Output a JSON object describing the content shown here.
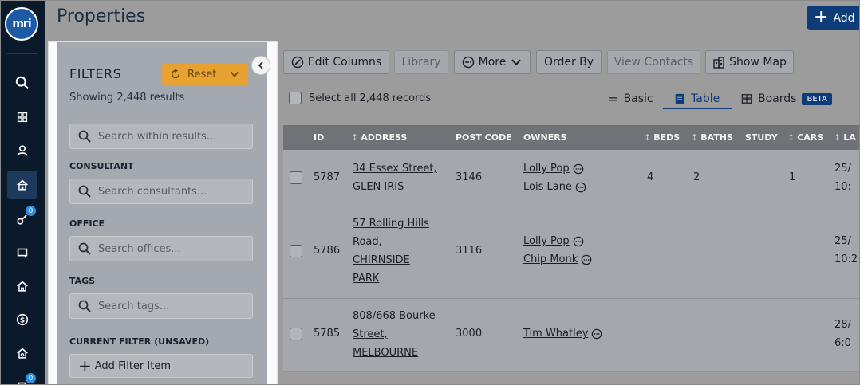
{
  "app": {
    "logo_text": "mri",
    "page_title": "Properties",
    "add_label": "Add"
  },
  "rail": {
    "items": [
      {
        "name": "search-icon"
      },
      {
        "name": "dashboard-icon"
      },
      {
        "name": "contacts-icon"
      },
      {
        "name": "properties-icon",
        "active": true
      },
      {
        "name": "keys-icon",
        "badge": "0"
      },
      {
        "name": "listings-icon"
      },
      {
        "name": "home-icon"
      },
      {
        "name": "money-icon"
      },
      {
        "name": "house-settings-icon"
      },
      {
        "name": "tasks-icon",
        "badge": "0"
      }
    ]
  },
  "filters": {
    "title": "FILTERS",
    "reset_label": "Reset",
    "showing": "Showing 2,448 results",
    "search_placeholder": "Search within results...",
    "consultant_label": "CONSULTANT",
    "consultant_placeholder": "Search consultants...",
    "office_label": "OFFICE",
    "office_placeholder": "Search offices...",
    "tags_label": "TAGS",
    "tags_placeholder": "Search tags...",
    "current_filter_label": "CURRENT FILTER (UNSAVED)",
    "add_filter_label": "Add Filter Item"
  },
  "toolbar": {
    "edit_columns": "Edit Columns",
    "library": "Library",
    "more": "More",
    "order_by": "Order By",
    "view_contacts": "View Contacts",
    "show_map": "Show Map"
  },
  "select_all": "Select all 2,448 records",
  "views": {
    "basic": "Basic",
    "table": "Table",
    "boards": "Boards",
    "beta": "BETA"
  },
  "columns": {
    "id": "ID",
    "address": "ADDRESS",
    "post_code": "POST CODE",
    "owners": "OWNERS",
    "beds": "BEDS",
    "baths": "BATHS",
    "study": "STUDY",
    "cars": "CARS",
    "last": "LA"
  },
  "rows": [
    {
      "id": "5787",
      "address": [
        "34 Essex Street,",
        "GLEN IRIS"
      ],
      "post_code": "3146",
      "owners": [
        "Lolly Pop",
        "Lois Lane"
      ],
      "beds": "4",
      "baths": "2",
      "cars": "1",
      "date": [
        "25/",
        "10:"
      ]
    },
    {
      "id": "5786",
      "address": [
        "57 Rolling Hills",
        "Road,",
        "CHIRNSIDE",
        "PARK"
      ],
      "post_code": "3116",
      "owners": [
        "Lolly Pop",
        "Chip Monk"
      ],
      "beds": "",
      "baths": "",
      "cars": "",
      "date": [
        "25/",
        "10:2"
      ]
    },
    {
      "id": "5785",
      "address": [
        "808/668 Bourke",
        "Street,",
        "MELBOURNE"
      ],
      "post_code": "3000",
      "owners": [
        "Tim Whatley"
      ],
      "beds": "",
      "baths": "",
      "cars": "",
      "date": [
        "28/",
        "6:0"
      ]
    }
  ]
}
